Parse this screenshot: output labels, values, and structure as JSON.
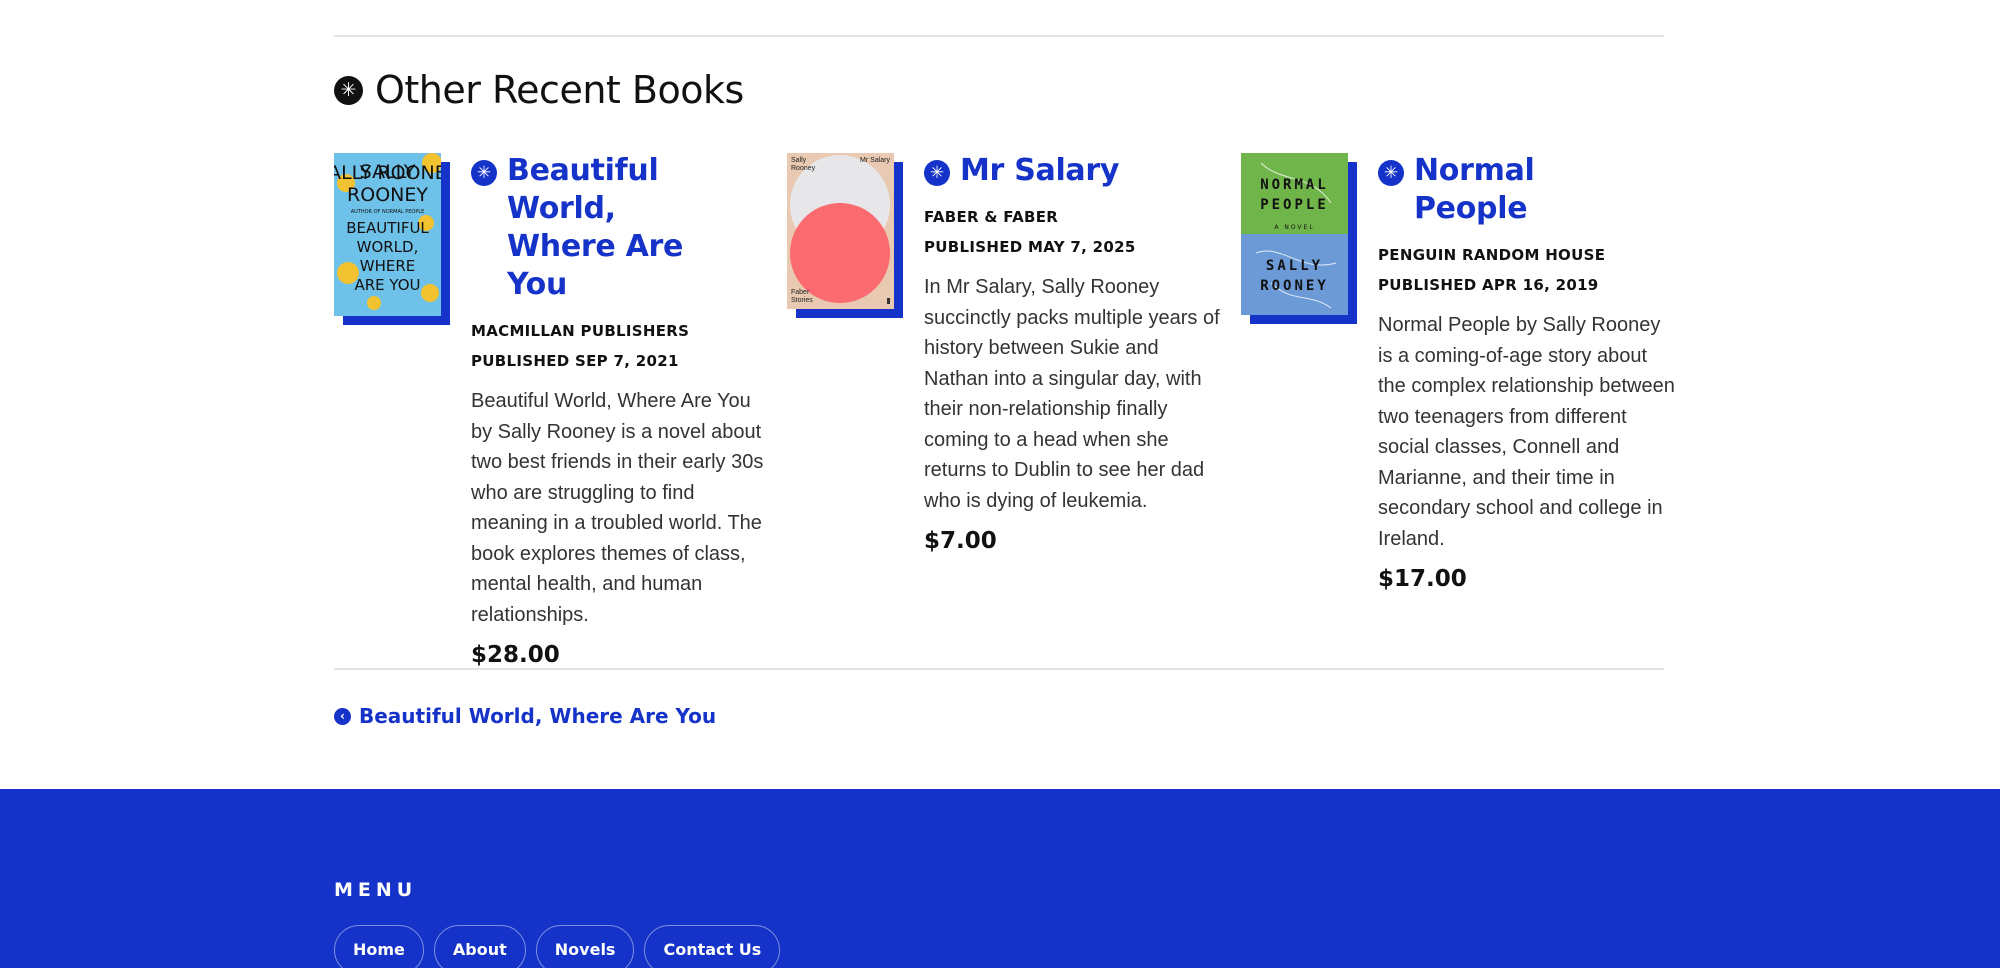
{
  "section": {
    "title": "Other Recent Books"
  },
  "books": [
    {
      "title": "Beautiful World, Where Are You",
      "publisher": "MACMILLAN PUBLISHERS",
      "published": "PUBLISHED SEP 7, 2021",
      "description": "Beautiful World, Where Are You by Sally Rooney is a novel about two best friends in their early 30s who are struggling to find meaning in a troubled world. The book explores themes of class, mental health, and human relationships.",
      "price": "$28.00",
      "cover": {
        "author": "SALLY ROONEY",
        "subtitle": "AUTHOR OF NORMAL PEOPLE",
        "title": "BEAUTIFUL WORLD, WHERE ARE YOU",
        "background": "#6ec1e8"
      }
    },
    {
      "title": "Mr Salary",
      "publisher": "FABER & FABER",
      "published": "PUBLISHED MAY 7, 2025",
      "description": "In Mr Salary, Sally Rooney succinctly packs multiple years of history between Sukie and Nathan into a singular day, with their non-relationship finally coming to a head when she returns to Dublin to see her dad who is dying of leukemia.",
      "price": "$7.00",
      "cover": {
        "author": "Sally Rooney",
        "title": "Mr Salary",
        "series": "Faber Stories",
        "background": "#e9c9b1"
      }
    },
    {
      "title": "Normal People",
      "publisher": "PENGUIN RANDOM HOUSE",
      "published": "PUBLISHED APR 16, 2019",
      "description": "Normal People by Sally Rooney is a coming-of-age story about the complex relationship between two teenagers from different social classes, Connell and Marianne, and their time in secondary school and college in Ireland.",
      "price": "$17.00",
      "cover": {
        "title": "NORMAL PEOPLE",
        "subtitle": "A NOVEL",
        "author": "SALLY ROONEY",
        "top_color": "#6fb54a",
        "bottom_color": "#6b9ad6"
      }
    }
  ],
  "previous_link": {
    "label": "Beautiful World, Where Are You",
    "icon": "chevron-left-circle-icon"
  },
  "footer": {
    "heading": "MENU",
    "nav": [
      "Home",
      "About",
      "Novels",
      "Contact Us"
    ]
  },
  "colors": {
    "accent": "#1533c8",
    "text": "#111111"
  }
}
